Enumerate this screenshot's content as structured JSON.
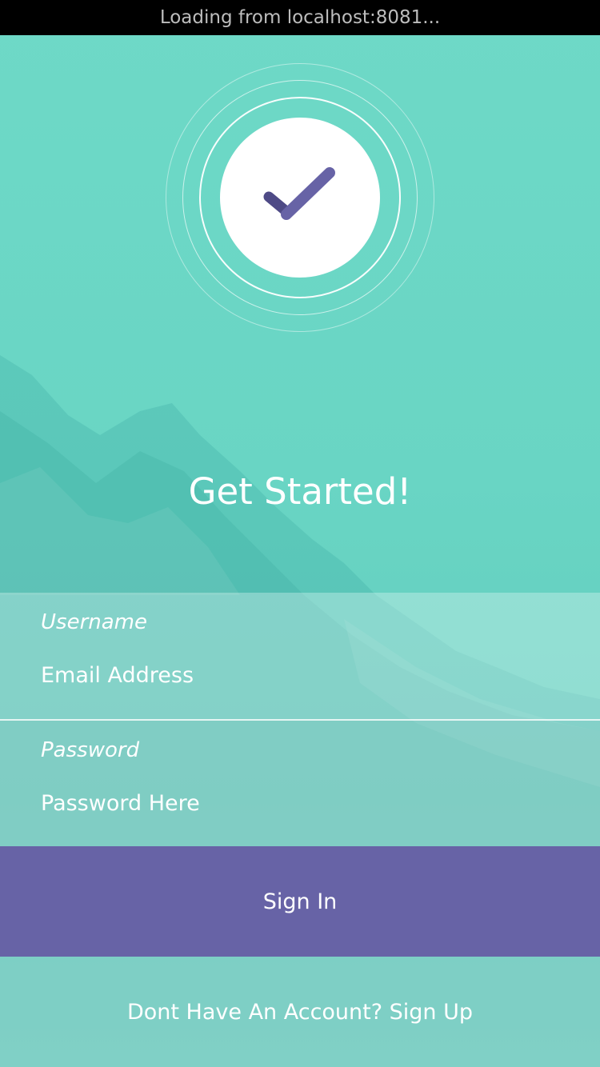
{
  "status_bar": {
    "text": "Loading from localhost:8081..."
  },
  "logo": {
    "icon": "checkmark-icon",
    "color": "#6763a6"
  },
  "title": "Get Started!",
  "form": {
    "username": {
      "label": "Username",
      "placeholder": "Email Address"
    },
    "password": {
      "label": "Password",
      "placeholder": "Password Here"
    }
  },
  "signin_button": {
    "label": "Sign In",
    "color": "#6763a6"
  },
  "footer": {
    "signup_text": "Dont Have An Account? Sign Up"
  },
  "colors": {
    "background": "#6ed9c7",
    "accent": "#6763a6"
  }
}
